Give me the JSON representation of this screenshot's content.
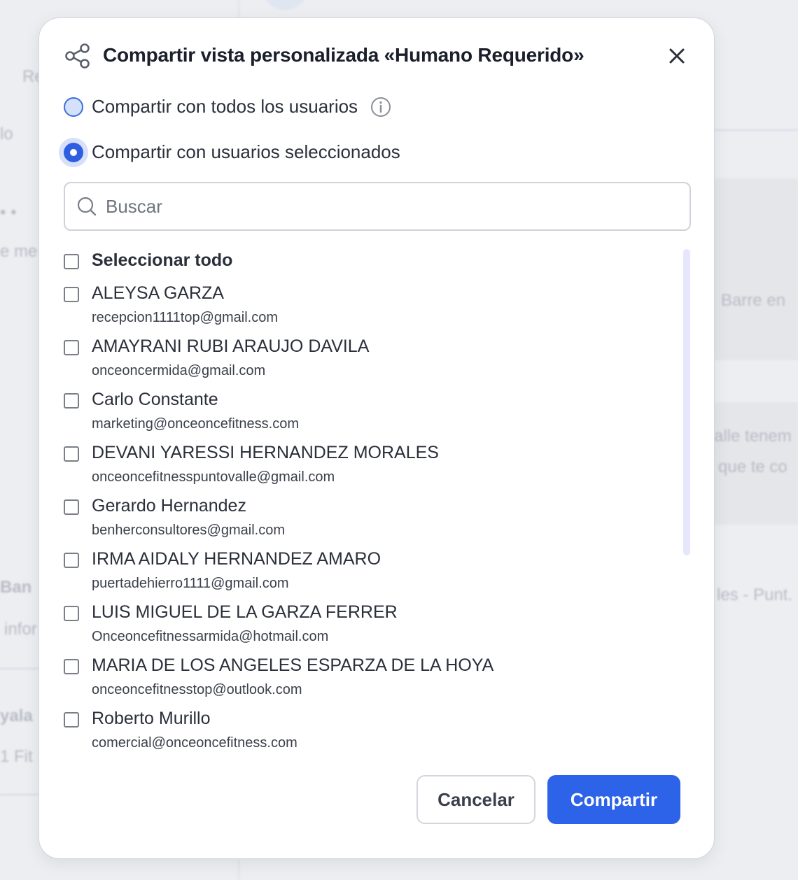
{
  "background": {
    "fragments": [
      "Re",
      "lo",
      "•  •",
      "e me",
      "Barre en",
      "alle tenem",
      "que te co",
      "Ban",
      "infor",
      "les - Punt.",
      "yala",
      "1 Fit"
    ]
  },
  "dialog": {
    "title": "Compartir vista personalizada «Humano Requerido»",
    "options": {
      "all_users": "Compartir con todos los usuarios",
      "selected_users": "Compartir con usuarios seleccionados",
      "selected": "selected_users"
    },
    "search": {
      "placeholder": "Buscar",
      "value": ""
    },
    "select_all_label": "Seleccionar todo",
    "users": [
      {
        "name": "ALEYSA GARZA",
        "email": "recepcion1111top@gmail.com",
        "checked": false
      },
      {
        "name": "AMAYRANI RUBI ARAUJO DAVILA",
        "email": "onceoncermida@gmail.com",
        "checked": false
      },
      {
        "name": "Carlo Constante",
        "email": "marketing@onceoncefitness.com",
        "checked": false
      },
      {
        "name": "DEVANI YARESSI HERNANDEZ MORALES",
        "email": "onceoncefitnesspuntovalle@gmail.com",
        "checked": false
      },
      {
        "name": "Gerardo Hernandez",
        "email": "benherconsultores@gmail.com",
        "checked": false
      },
      {
        "name": "IRMA AIDALY HERNANDEZ AMARO",
        "email": "puertadehierro1111@gmail.com",
        "checked": false
      },
      {
        "name": "LUIS MIGUEL DE LA GARZA FERRER",
        "email": "Onceoncefitnessarmida@hotmail.com",
        "checked": false
      },
      {
        "name": "MARIA DE LOS ANGELES ESPARZA DE LA HOYA",
        "email": "onceoncefitnesstop@outlook.com",
        "checked": false
      },
      {
        "name": "Roberto Murillo",
        "email": "comercial@onceoncefitness.com",
        "checked": false
      }
    ],
    "buttons": {
      "cancel": "Cancelar",
      "share": "Compartir"
    }
  },
  "colors": {
    "primary": "#2d63e8",
    "radio_ring": "#d6e0fb",
    "scrollbar": "#e6e7fa"
  },
  "icons": {
    "header": "share-icon",
    "close": "close-icon",
    "info": "info-icon",
    "search": "search-icon"
  }
}
